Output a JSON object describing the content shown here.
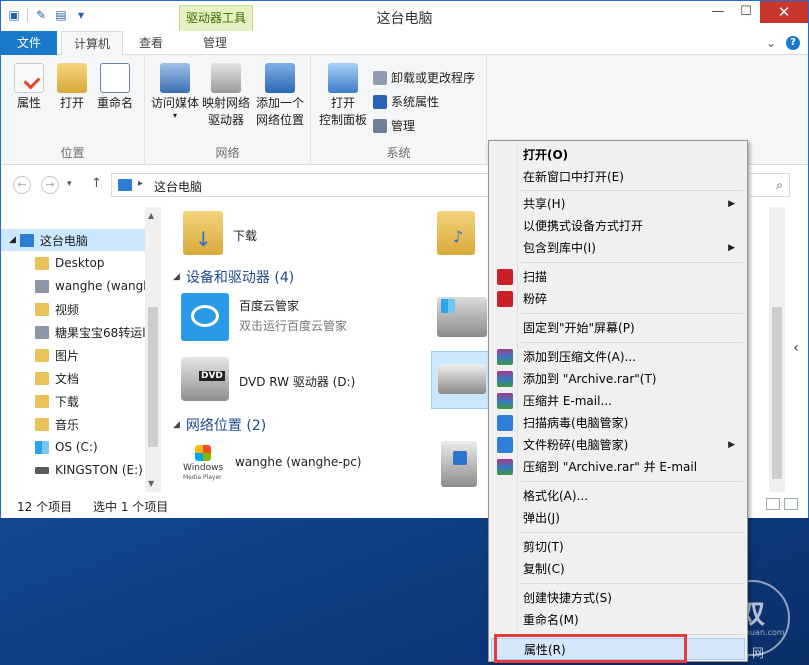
{
  "window": {
    "title": "这台电脑",
    "contextual_tab_group": "驱动器工具"
  },
  "tabs": [
    {
      "label": "文件"
    },
    {
      "label": "计算机"
    },
    {
      "label": "查看"
    },
    {
      "label": "管理"
    }
  ],
  "ribbon": {
    "groups": {
      "location": "位置",
      "network": "网络",
      "system": "系统"
    },
    "buttons": {
      "properties": "属性",
      "open": "打开",
      "rename": "重命名",
      "access_media": "访问媒体",
      "map_drive_1": "映射网络",
      "map_drive_2": "驱动器",
      "add_location_1": "添加一个",
      "add_location_2": "网络位置",
      "control_panel_1": "打开",
      "control_panel_2": "控制面板",
      "uninstall": "卸载或更改程序",
      "system_props": "系统属性",
      "manage": "管理"
    }
  },
  "address": {
    "crumb": "这台电脑"
  },
  "navpane": {
    "items": [
      {
        "label": "这台电脑"
      },
      {
        "label": "Desktop"
      },
      {
        "label": "wanghe (wangh"
      },
      {
        "label": "视频"
      },
      {
        "label": "糖果宝宝68转运l"
      },
      {
        "label": "图片"
      },
      {
        "label": "文档"
      },
      {
        "label": "下载"
      },
      {
        "label": "音乐"
      },
      {
        "label": "OS (C:)"
      },
      {
        "label": "KINGSTON (E:)"
      }
    ]
  },
  "content": {
    "downloads_label": "下载",
    "devices_header": "设备和驱动器 (4)",
    "network_header": "网络位置 (2)",
    "baidu_name": "百度云管家",
    "baidu_sub": "双击运行百度云管家",
    "dvd_label": "DVD RW 驱动器 (D:)",
    "dvd_badge": "DVD",
    "media_player_name": "wanghe (wanghe-pc)",
    "wmp_brand_1": "Windows",
    "wmp_brand_2": "Media Player"
  },
  "status": {
    "count": "12 个项目",
    "selected": "选中 1 个项目"
  },
  "context_menu": {
    "items": [
      {
        "label": "打开(O)",
        "bold": true
      },
      {
        "label": "在新窗口中打开(E)"
      },
      {
        "label": "共享(H)",
        "submenu": true
      },
      {
        "label": "以便携式设备方式打开"
      },
      {
        "label": "包含到库中(I)",
        "submenu": true
      },
      {
        "label": "扫描"
      },
      {
        "label": "粉碎"
      },
      {
        "label": "固定到\"开始\"屏幕(P)"
      },
      {
        "label": "添加到压缩文件(A)..."
      },
      {
        "label": "添加到 \"Archive.rar\"(T)"
      },
      {
        "label": "压缩并 E-mail..."
      },
      {
        "label": "扫描病毒(电脑管家)"
      },
      {
        "label": "文件粉碎(电脑管家)",
        "submenu": true
      },
      {
        "label": "压缩到 \"Archive.rar\" 并 E-mail"
      },
      {
        "label": "格式化(A)..."
      },
      {
        "label": "弹出(J)"
      },
      {
        "label": "剪切(T)"
      },
      {
        "label": "复制(C)"
      },
      {
        "label": "创建快捷方式(S)"
      },
      {
        "label": "重命名(M)"
      },
      {
        "label": "属性(R)"
      }
    ]
  },
  "watermark": {
    "logo": "双",
    "url": "www.shuan.com",
    "name": "双视网"
  },
  "colors": {
    "accent": "#1979ca",
    "selection": "#cce8ff",
    "highlight_box": "#e43b3b",
    "contextual_tab": "#e6f2c4"
  }
}
